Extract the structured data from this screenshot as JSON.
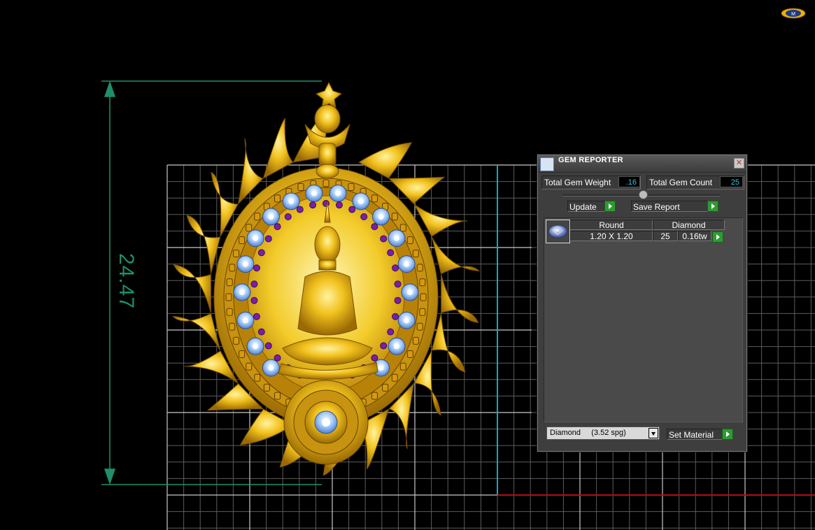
{
  "viewport": {
    "dimension_value": "24.47",
    "background_color": "#000000",
    "grid_color": "#5c5c5c",
    "dimension_color": "#1f8f6a",
    "axis_color": "#b01010",
    "boundary_color": "#1aa7b8",
    "model": "gold-buddha-pendant-with-gems",
    "gold_color": "#e9b214",
    "gem_blue_color": "#7fb3f0",
    "gem_purple_color": "#7a1fa8"
  },
  "gem_reporter": {
    "title": "GEM REPORTER",
    "total_gem_weight_label": "Total Gem Weight",
    "total_gem_weight_value": ".16",
    "total_gem_count_label": "Total Gem Count",
    "total_gem_count_value": "25",
    "update_label": "Update",
    "save_report_label": "Save Report",
    "gem_rows": [
      {
        "shape": "Round",
        "material": "Diamond",
        "size": "1.20 X 1.20",
        "count": "25",
        "weight": "0.16tw"
      }
    ],
    "material_select": "Diamond     (3.52 spg)",
    "set_material_label": "Set Material"
  },
  "icons": {
    "app_icon": "gem-report-icon",
    "close_icon": "close-icon",
    "gem_thumbnail": "round-gem-icon",
    "logo": "matrix-logo-icon"
  }
}
